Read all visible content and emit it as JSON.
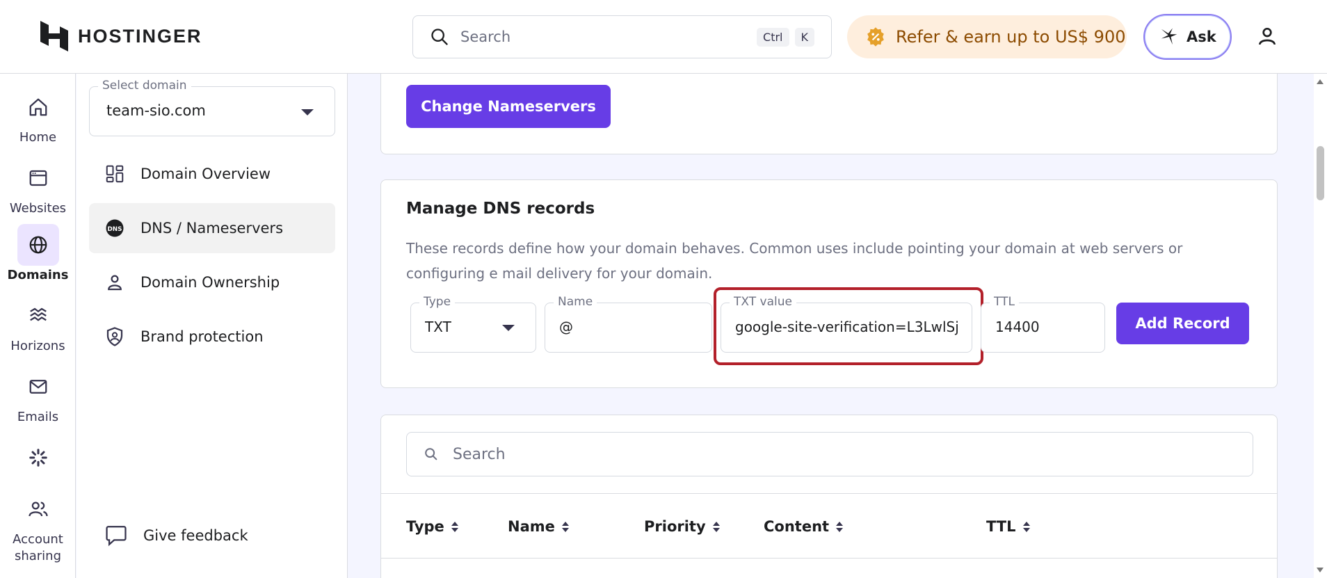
{
  "brand": {
    "name": "HOSTINGER"
  },
  "header": {
    "search_placeholder": "Search",
    "shortcut_ctrl": "Ctrl",
    "shortcut_k": "K",
    "refer_label": "Refer & earn up to US$ 900",
    "ask_label": "Ask"
  },
  "leftnav": {
    "items": [
      {
        "label": "Home",
        "icon": "home-icon"
      },
      {
        "label": "Websites",
        "icon": "browser-icon"
      },
      {
        "label": "Domains",
        "icon": "globe-icon",
        "active": true
      },
      {
        "label": "Horizons",
        "icon": "horizons-icon"
      },
      {
        "label": "Emails",
        "icon": "mail-icon"
      },
      {
        "label": "",
        "icon": "loading-spinner-icon"
      },
      {
        "label": "Account sharing",
        "icon": "users-icon"
      }
    ]
  },
  "subnav": {
    "select_label": "Select domain",
    "select_value": "team-sio.com",
    "items": [
      {
        "label": "Domain Overview",
        "icon": "grid-icon"
      },
      {
        "label": "DNS / Nameservers",
        "icon": "dns-icon",
        "active": true
      },
      {
        "label": "Domain Ownership",
        "icon": "person-icon"
      },
      {
        "label": "Brand protection",
        "icon": "shield-icon"
      }
    ],
    "feedback_label": "Give feedback"
  },
  "nameservers": {
    "button_label": "Change Nameservers"
  },
  "dns": {
    "title": "Manage DNS records",
    "description": "These records define how your domain behaves. Common uses include pointing your domain at web servers or configuring e mail delivery for your domain.",
    "type_label": "Type",
    "type_value": "TXT",
    "name_label": "Name",
    "name_value": "@",
    "txt_label": "TXT value",
    "txt_value": "google-site-verification=L3LwlSj",
    "ttl_label": "TTL",
    "ttl_value": "14400",
    "add_button": "Add Record"
  },
  "records_table": {
    "search_placeholder": "Search",
    "columns": [
      "Type",
      "Name",
      "Priority",
      "Content",
      "TTL"
    ]
  },
  "colors": {
    "primary": "#673de6",
    "highlight": "#b3202a",
    "refer_bg": "#feeedd",
    "refer_text": "#8c4b00"
  }
}
